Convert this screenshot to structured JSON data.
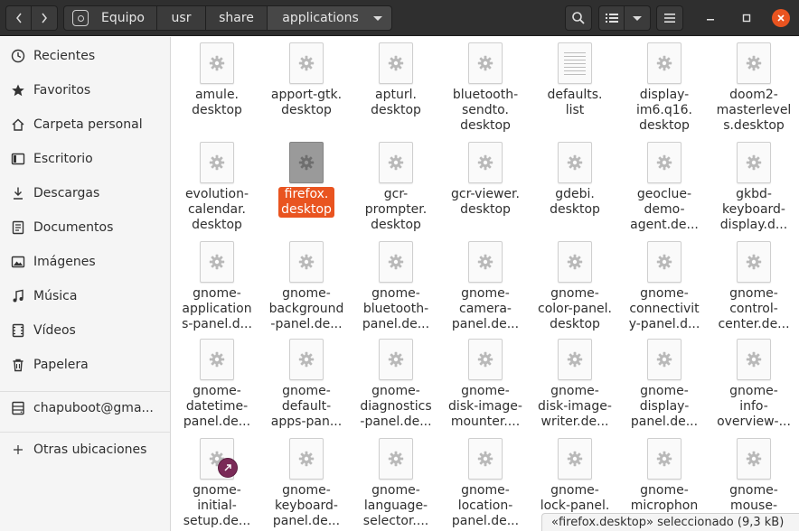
{
  "header": {
    "path": [
      {
        "label": "Equipo",
        "icon": "drive-icon"
      },
      {
        "label": "usr"
      },
      {
        "label": "share"
      },
      {
        "label": "applications",
        "current": true
      }
    ]
  },
  "sidebar": {
    "items": [
      {
        "label": "Recientes",
        "icon": "clock-icon"
      },
      {
        "label": "Favoritos",
        "icon": "star-icon"
      },
      {
        "label": "Carpeta personal",
        "icon": "home-icon"
      },
      {
        "label": "Escritorio",
        "icon": "desktop-icon"
      },
      {
        "label": "Descargas",
        "icon": "download-icon"
      },
      {
        "label": "Documentos",
        "icon": "document-icon"
      },
      {
        "label": "Imágenes",
        "icon": "image-icon"
      },
      {
        "label": "Música",
        "icon": "music-icon"
      },
      {
        "label": "Vídeos",
        "icon": "video-icon"
      },
      {
        "label": "Papelera",
        "icon": "trash-icon"
      }
    ],
    "network": {
      "label": "chapuboot@gma...",
      "icon": "network-drive-icon"
    },
    "other": {
      "label": "Otras ubicaciones",
      "icon": "plus-icon"
    }
  },
  "files": [
    {
      "name": "amule.\ndesktop"
    },
    {
      "name": "apport-gtk.\ndesktop"
    },
    {
      "name": "apturl.\ndesktop"
    },
    {
      "name": "bluetooth-\nsendto.\ndesktop"
    },
    {
      "name": "defaults.\nlist",
      "kind": "text"
    },
    {
      "name": "display-\nim6.q16.\ndesktop"
    },
    {
      "name": "doom2-\nmasterlevel\ns.desktop"
    },
    {
      "name": "evolution-\ncalendar.\ndesktop"
    },
    {
      "name": "firefox.\ndesktop",
      "selected": true
    },
    {
      "name": "gcr-\nprompter.\ndesktop"
    },
    {
      "name": "gcr-viewer.\ndesktop"
    },
    {
      "name": "gdebi.\ndesktop"
    },
    {
      "name": "geoclue-\ndemo-\nagent.de..."
    },
    {
      "name": "gkbd-\nkeyboard-\ndisplay.d..."
    },
    {
      "name": "gnome-\napplication\ns-panel.d..."
    },
    {
      "name": "gnome-\nbackground\n-panel.de..."
    },
    {
      "name": "gnome-\nbluetooth-\npanel.de..."
    },
    {
      "name": "gnome-\ncamera-\npanel.de..."
    },
    {
      "name": "gnome-\ncolor-panel.\ndesktop"
    },
    {
      "name": "gnome-\nconnectivit\ny-panel.d..."
    },
    {
      "name": "gnome-\ncontrol-\ncenter.de..."
    },
    {
      "name": "gnome-\ndatetime-\npanel.de..."
    },
    {
      "name": "gnome-\ndefault-\napps-pan..."
    },
    {
      "name": "gnome-\ndiagnostics\n-panel.de..."
    },
    {
      "name": "gnome-\ndisk-image-\nmounter...."
    },
    {
      "name": "gnome-\ndisk-image-\nwriter.de..."
    },
    {
      "name": "gnome-\ndisplay-\npanel.de..."
    },
    {
      "name": "gnome-\ninfo-\noverview-..."
    },
    {
      "name": "gnome-\ninitial-\nsetup.de...",
      "link": true
    },
    {
      "name": "gnome-\nkeyboard-\npanel.de..."
    },
    {
      "name": "gnome-\nlanguage-\nselector...."
    },
    {
      "name": "gnome-\nlocation-\npanel.de..."
    },
    {
      "name": "gnome-\nlock-panel.\n..."
    },
    {
      "name": "gnome-\nmicrophon\n..."
    },
    {
      "name": "gnome-\nmouse-\n..."
    }
  ],
  "status": "«firefox.desktop» seleccionado  (9,3 kB)"
}
